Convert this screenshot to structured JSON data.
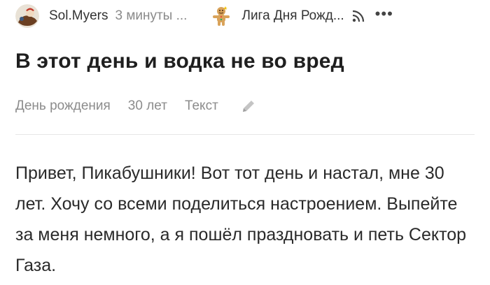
{
  "header": {
    "author": "Sol.Myers",
    "time": "3 минуты ...",
    "community": "Лига Дня Рожд...",
    "more_icon": "more-dots-icon",
    "rss_icon": "rss-icon"
  },
  "post": {
    "title": "В этот день и водка не во вред",
    "tags": [
      "День рождения",
      "30 лет",
      "Текст"
    ],
    "edit_icon": "pencil-icon",
    "body": "Привет, Пикабушники! Вот тот день и настал, мне 30 лет. Хочу со всеми поделиться настроением. Выпейте за меня немного, а я пошёл праздновать и петь Сектор Газа."
  },
  "colors": {
    "muted": "#8c8c8c",
    "text": "#222222",
    "divider": "#e6e6e6"
  }
}
